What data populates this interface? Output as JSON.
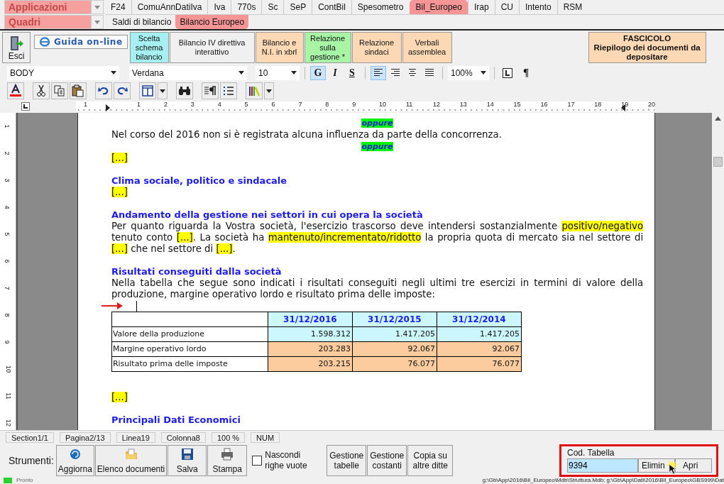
{
  "app_selector": {
    "value": "Applicazioni"
  },
  "app_tabs": [
    {
      "label": "F24",
      "selected": false
    },
    {
      "label": "ComuAnnDatiIva",
      "selected": false
    },
    {
      "label": "Iva",
      "selected": false
    },
    {
      "label": "770s",
      "selected": false
    },
    {
      "label": "Sc",
      "selected": false
    },
    {
      "label": "SeP",
      "selected": false
    },
    {
      "label": "ContBil",
      "selected": false
    },
    {
      "label": "Spesometro",
      "selected": false
    },
    {
      "label": "Bil_Europeo",
      "selected": true
    },
    {
      "label": "Irap",
      "selected": false
    },
    {
      "label": "CU",
      "selected": false
    },
    {
      "label": "Intento",
      "selected": false
    },
    {
      "label": "RSM",
      "selected": false
    }
  ],
  "section_selector": {
    "value": "Quadri"
  },
  "section_tabs": [
    {
      "label": "Saldi di bilancio",
      "selected": false
    },
    {
      "label": "Bilancio Europeo",
      "selected": true
    }
  ],
  "toolbar": {
    "exit": "Esci",
    "help": "Guida on-line",
    "buttons": [
      {
        "label": "Scelta schema bilancio",
        "color": "#a6f0f2"
      },
      {
        "label": "Bilancio IV direttiva interattivo",
        "color": "#f0f0f0"
      },
      {
        "label": "Bilancio e N.I. in xbrl",
        "color": "#fdd8b4"
      },
      {
        "label": "Relazione sulla gestione *",
        "color": "#a8f5a6"
      },
      {
        "label": "Relazione sindaci",
        "color": "#fdd8b4"
      },
      {
        "label": "Verbali assemblea",
        "color": "#fdd8b4"
      }
    ],
    "fascicolo": {
      "title": "FASCICOLO",
      "label": "Riepilogo dei documenti da depositare"
    }
  },
  "format_bar": {
    "style": "BODY",
    "font": "Verdana",
    "size": "10",
    "text_styles": [
      {
        "label": "G",
        "kind": "bold",
        "selected": true
      },
      {
        "label": "I",
        "kind": "italic",
        "selected": false
      },
      {
        "label": "S",
        "kind": "underline",
        "selected": false
      }
    ],
    "alignment": [
      {
        "kind": "left",
        "selected": true
      },
      {
        "kind": "right",
        "selected": false
      },
      {
        "kind": "center",
        "selected": false
      },
      {
        "kind": "justify",
        "selected": false
      }
    ],
    "zoom": "100%",
    "marks": {
      "label": "¶",
      "selected": false
    }
  },
  "ruler_marks": [
    "1",
    "1",
    "2",
    "3",
    "4",
    "5",
    "6",
    "7",
    "8",
    "9",
    "10",
    "11",
    "12",
    "13",
    "14",
    "15",
    "16",
    "17",
    "18",
    "19",
    "20"
  ],
  "vertical_ruler_marks": [
    "1",
    "2",
    "3",
    "4",
    "5",
    "6",
    "7",
    "8",
    "9",
    "10",
    "11",
    "12"
  ],
  "document": [
    {
      "kind": "alt",
      "text": "oppure"
    },
    {
      "kind": "paragraph",
      "parts": [
        {
          "text": "Nel corso del 2016 non si è registrata alcuna influenza da parte della concorrenza.",
          "highlight": false
        }
      ]
    },
    {
      "kind": "alt",
      "text": "oppure"
    },
    {
      "kind": "paragraph",
      "parts": [
        {
          "text": "[...]",
          "highlight": true
        }
      ]
    },
    {
      "kind": "heading",
      "text": "Clima sociale, politico e sindacale"
    },
    {
      "kind": "paragraph",
      "parts": [
        {
          "text": "[...]",
          "highlight": true
        }
      ]
    },
    {
      "kind": "heading",
      "text": "Andamento della gestione nei settori in cui opera la società"
    },
    {
      "kind": "paragraph",
      "parts": [
        {
          "text": "Per quanto riguarda la Vostra società, l'esercizio trascorso deve intendersi sostanzialmente ",
          "highlight": false
        },
        {
          "text": "positivo/negativo",
          "highlight": true
        },
        {
          "text": " tenuto conto ",
          "highlight": false
        },
        {
          "text": "[...]",
          "highlight": true
        },
        {
          "text": ". La società ha ",
          "highlight": false
        },
        {
          "text": "mantenuto/incrementato/ridotto",
          "highlight": true
        },
        {
          "text": " la propria quota di mercato sia nel settore di ",
          "highlight": false
        },
        {
          "text": "[...]",
          "highlight": true
        },
        {
          "text": " che nel settore di ",
          "highlight": false
        },
        {
          "text": "[...]",
          "highlight": true
        },
        {
          "text": ".",
          "highlight": false
        }
      ]
    },
    {
      "kind": "heading",
      "text": "Risultati conseguiti dalla società"
    },
    {
      "kind": "paragraph",
      "parts": [
        {
          "text": "Nella tabella che segue sono indicati i risultati conseguiti negli ultimi tre esercizi in termini di valore della produzione, margine operativo lordo e risultato prima delle imposte:",
          "highlight": false
        }
      ]
    },
    {
      "kind": "cursor"
    },
    {
      "kind": "table",
      "columns": [
        "31/12/2016",
        "31/12/2015",
        "31/12/2014"
      ],
      "rows": [
        {
          "label": "Valore della produzione",
          "values": [
            "1.598.312",
            "1.417.205",
            "1.417.205"
          ],
          "color": "#ccf7ff"
        },
        {
          "label": "Margine operativo lordo",
          "values": [
            "203.283",
            "92.067",
            "92.067"
          ],
          "color": "#fdcc9e"
        },
        {
          "label": "Risultato prima delle imposte",
          "values": [
            "203.215",
            "76.077",
            "76.077"
          ],
          "color": "#fdcc9e"
        }
      ]
    },
    {
      "kind": "gap_paragraph",
      "parts": [
        {
          "text": "[...]",
          "highlight": true
        }
      ]
    },
    {
      "kind": "heading",
      "text": "Principali Dati Economici"
    }
  ],
  "status_panes": [
    "Section1/1",
    "Pagina2/13",
    "Linea19",
    "Colonna8",
    "100 %",
    "NUM"
  ],
  "tools": {
    "label": "Strumenti:",
    "buttons": [
      {
        "label": "Aggiorna",
        "kind": "refresh"
      },
      {
        "label": "Elenco documenti",
        "kind": "folder"
      },
      {
        "label": "Salva",
        "kind": "save"
      },
      {
        "label": "Stampa",
        "kind": "print"
      }
    ],
    "hide_empty_rows": {
      "label": "Nascondi righe vuote",
      "checked": false
    },
    "text_buttons": [
      "Gestione tabelle",
      "Gestione costanti",
      "Copia su altre ditte"
    ]
  },
  "table_code": {
    "label": "Cod. Tabella",
    "value": "9394",
    "buttons": [
      "Elimin",
      "Apri"
    ]
  },
  "status_bar": {
    "state": "Pronto",
    "path": "g:\\Gb\\App\\2016\\Bil_Europeo\\Mdb\\Struttura.Mdb; g:\\Gb\\App\\Dati\\2016\\Bil_Europeo\\GBS999\\Dat"
  }
}
